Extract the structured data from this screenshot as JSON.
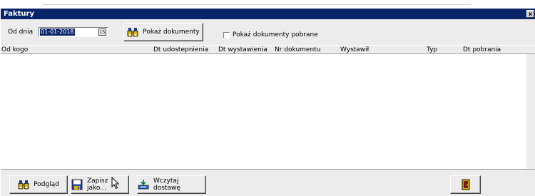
{
  "window": {
    "title": "Faktury",
    "close_glyph": "x"
  },
  "toolbar": {
    "date_label": "Od dnia",
    "date_value": "01-01-2018",
    "calendar_glyph": "15",
    "show_documents_label": "Pokaż dokumenty",
    "show_downloaded_label": "Pokaż dokumenty pobrane",
    "show_downloaded_checked": false
  },
  "grid": {
    "columns": [
      "Od kogo",
      "Dt udostepnienia",
      "Dt wystawienia",
      "Nr dokumentu",
      "Wystawił",
      "Typ",
      "Dt pobrania"
    ],
    "rows": []
  },
  "bottom": {
    "preview_label": "Podgląd",
    "save_label": "Zapisz jako...",
    "load_label": "Wczytaj dostawę"
  },
  "icons": {
    "preview": "binoculars-icon",
    "show_documents": "binoculars-icon",
    "save": "floppy-disk-icon",
    "load": "tray-load-icon",
    "exit": "door-exit-icon"
  },
  "colors": {
    "titlebar": "#0a246a",
    "window_bg": "#ececec",
    "grid_bg": "#ffffff",
    "selection": "#0a246a"
  }
}
